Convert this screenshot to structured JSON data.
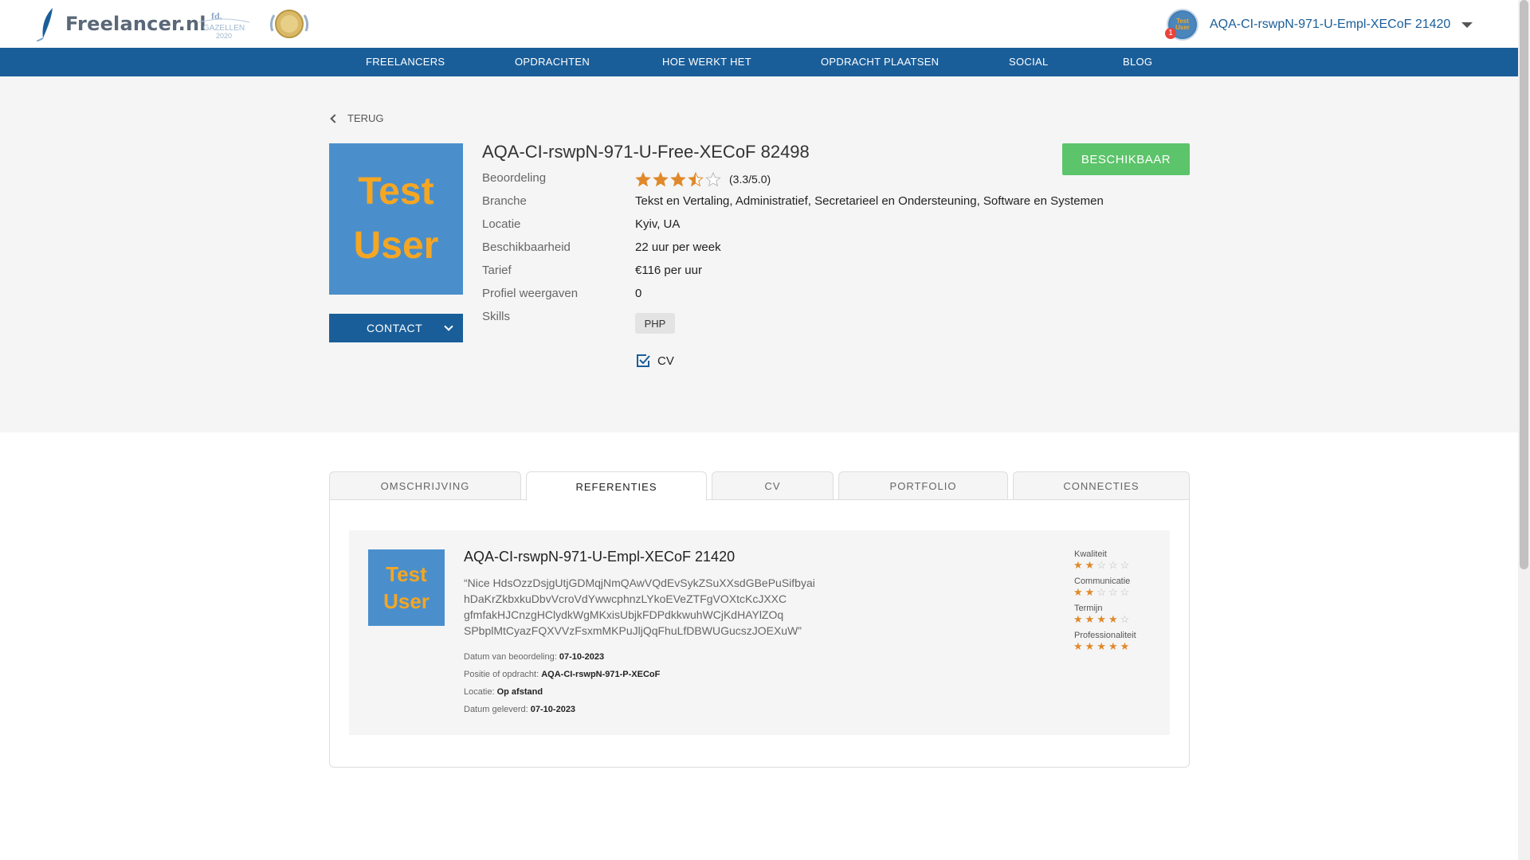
{
  "header": {
    "logo_text": "Freelancer.nl",
    "badge_gazellen_text": "GAZELLEN",
    "badge_gazellen_year": "2020",
    "user_name": "AQA-CI-rswpN-971-U-Empl-XECoF 21420",
    "notification_count": "1",
    "avatar_text": "Test User"
  },
  "nav": {
    "items": [
      "FREELANCERS",
      "OPDRACHTEN",
      "HOE WERKT HET",
      "OPDRACHT PLAATSEN",
      "SOCIAL",
      "BLOG"
    ]
  },
  "profile": {
    "back_label": "TERUG",
    "image_line1": "Test",
    "image_line2": "User",
    "contact_label": "CONTACT",
    "name": "AQA-CI-rswpN-971-U-Free-XECoF 82498",
    "availability_label": "BESCHIKBAAR",
    "rating_value": 3.5,
    "rating_text": "(3.3/5.0)",
    "fields": [
      {
        "label": "Beoordeling",
        "value": ""
      },
      {
        "label": "Branche",
        "value": "Tekst en Vertaling, Administratief, Secretarieel en Ondersteuning, Software en Systemen"
      },
      {
        "label": "Locatie",
        "value": "Kyiv, UA"
      },
      {
        "label": "Beschikbaarheid",
        "value": "22 uur per week"
      },
      {
        "label": "Tarief",
        "value": "€116 per uur"
      },
      {
        "label": "Profiel weergaven",
        "value": "0"
      },
      {
        "label": "Skills",
        "value": ""
      }
    ],
    "skills": [
      "PHP"
    ],
    "cv_label": "CV"
  },
  "tabs": {
    "items": [
      "OMSCHRIJVING",
      "REFERENTIES",
      "CV",
      "PORTFOLIO",
      "CONNECTIES"
    ],
    "active": "REFERENTIES"
  },
  "reference": {
    "image_line1": "Test",
    "image_line2": "User",
    "name": "AQA-CI-rswpN-971-U-Empl-XECoF 21420",
    "quote": "“Nice HdsOzzDsjgUtjGDMqjNmQAwVQdEvSykZSuXXsdGBePuSifbyai hDaKrZkbxkuDbvVcroVdYwwcphnzLYkoEVeZTFgVOXtcKcJXXC gfmfakHJCnzgHClydkWgMKxisUbjkFDPdkkwuhWCjKdHAYlZOq SPbplMtCyazFQXVVzFsxmMKPuJljQqFhuLfDBWUGucszJOEXuW”",
    "meta": [
      {
        "label": "Datum van beoordeling:",
        "value": "07-10-2023"
      },
      {
        "label": "Positie of opdracht:",
        "value": "AQA-CI-rswpN-971-P-XECoF"
      },
      {
        "label": "Locatie:",
        "value": "Op afstand"
      },
      {
        "label": "Datum geleverd:",
        "value": "07-10-2023"
      }
    ],
    "scores": [
      {
        "label": "Kwaliteit",
        "value": 2
      },
      {
        "label": "Communicatie",
        "value": 2
      },
      {
        "label": "Termijn",
        "value": 4
      },
      {
        "label": "Professionaliteit",
        "value": 5
      }
    ]
  },
  "colors": {
    "brand_blue": "#1a5e99",
    "available_green": "#5cc46a",
    "star_orange": "#e0892a",
    "avatar_blue": "#4a8fcc",
    "avatar_text": "#f5a623"
  }
}
